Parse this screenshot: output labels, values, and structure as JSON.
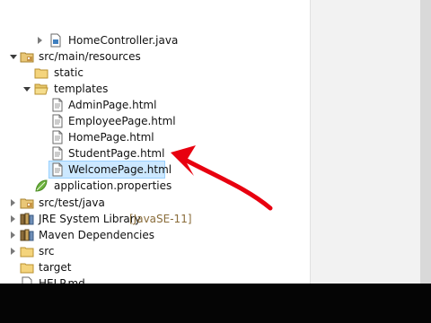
{
  "tree": {
    "partial_file": "HomeController.java",
    "src_main_resources": "src/main/resources",
    "static": "static",
    "templates": "templates",
    "files": [
      "AdminPage.html",
      "EmployeePage.html",
      "HomePage.html",
      "StudentPage.html",
      "WelcomePage.html"
    ],
    "application_properties": "application.properties",
    "src_test_java": "src/test/java",
    "jre_library": "JRE System Library",
    "jre_version": "[JavaSE-11]",
    "maven_dependencies": "Maven Dependencies",
    "src": "src",
    "target": "target",
    "help_md": "HELP.md"
  },
  "annotation": {
    "arrow_color": "#e8000f"
  }
}
